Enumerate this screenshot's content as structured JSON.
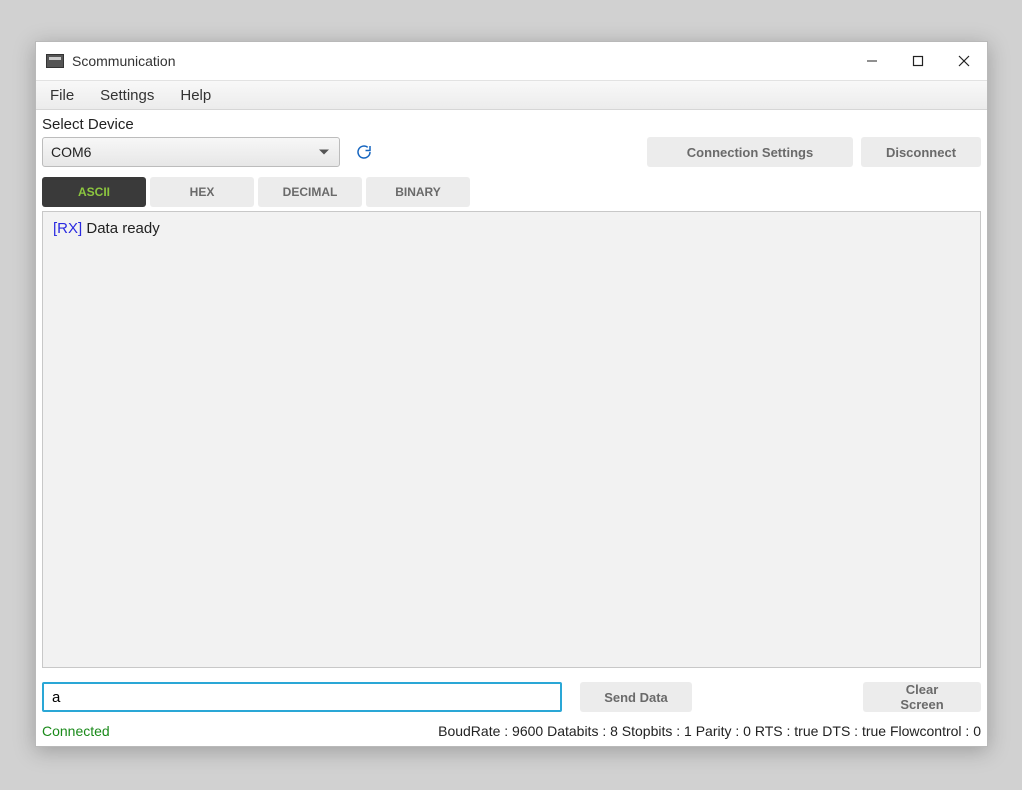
{
  "window": {
    "title": "Scommunication"
  },
  "menu": {
    "file": "File",
    "settings": "Settings",
    "help": "Help"
  },
  "device": {
    "label": "Select Device",
    "selected": "COM6"
  },
  "buttons": {
    "connection_settings": "Connection Settings",
    "disconnect": "Disconnect",
    "send_data": "Send Data",
    "clear_screen": "Clear Screen"
  },
  "tabs": {
    "ascii": "ASCII",
    "hex": "HEX",
    "decimal": "DECIMAL",
    "binary": "BINARY"
  },
  "log": {
    "line0_tag": "[RX]",
    "line0_msg": " Data ready"
  },
  "send": {
    "value": "a"
  },
  "status": {
    "connected": "Connected",
    "details": "BoudRate : 9600 Databits : 8 Stopbits : 1 Parity : 0 RTS : true DTS : true Flowcontrol : 0"
  }
}
